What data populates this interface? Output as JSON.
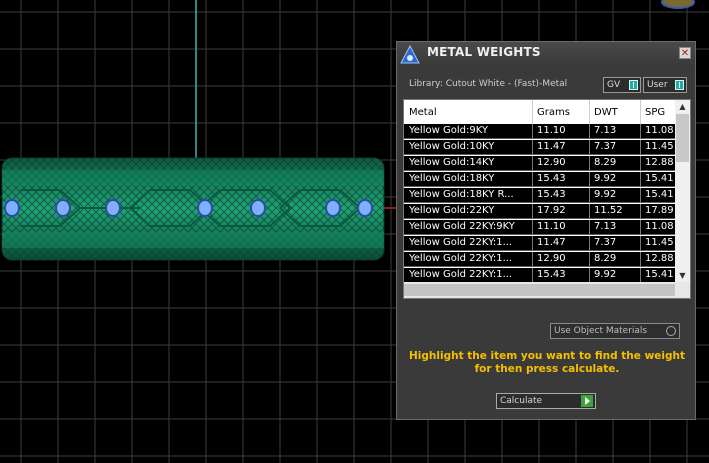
{
  "window": {
    "title": "METAL WEIGHTS",
    "close_label": "✕"
  },
  "library": {
    "label": "Library: Cutout White - (Fast)-Metal",
    "toggles": [
      {
        "label": "GV"
      },
      {
        "label": "User"
      }
    ]
  },
  "table": {
    "columns": [
      "Metal",
      "Grams",
      "DWT",
      "SPG"
    ],
    "rows": [
      {
        "metal": "Yellow Gold:9KY",
        "grams": "11.10",
        "dwt": "7.13",
        "spg": "11.08"
      },
      {
        "metal": "Yellow Gold:10KY",
        "grams": "11.47",
        "dwt": "7.37",
        "spg": "11.45"
      },
      {
        "metal": "Yellow Gold:14KY",
        "grams": "12.90",
        "dwt": "8.29",
        "spg": "12.88"
      },
      {
        "metal": "Yellow Gold:18KY",
        "grams": "15.43",
        "dwt": "9.92",
        "spg": "15.41"
      },
      {
        "metal": "Yellow Gold:18KY R...",
        "grams": "15.43",
        "dwt": "9.92",
        "spg": "15.41"
      },
      {
        "metal": "Yellow Gold:22KY",
        "grams": "17.92",
        "dwt": "11.52",
        "spg": "17.89"
      },
      {
        "metal": "Yellow Gold 22KY:9KY",
        "grams": "11.10",
        "dwt": "7.13",
        "spg": "11.08"
      },
      {
        "metal": "Yellow Gold 22KY:1...",
        "grams": "11.47",
        "dwt": "7.37",
        "spg": "11.45"
      },
      {
        "metal": "Yellow Gold 22KY:1...",
        "grams": "12.90",
        "dwt": "8.29",
        "spg": "12.88"
      },
      {
        "metal": "Yellow Gold 22KY:1...",
        "grams": "15.43",
        "dwt": "9.92",
        "spg": "15.41"
      },
      {
        "metal": "Yellow Gold 22KY:1...",
        "grams": "15.43",
        "dwt": "9.92",
        "spg": "15.41"
      }
    ]
  },
  "object_materials": {
    "label": "Use Object Materials"
  },
  "hint": {
    "line1": "Highlight the item you want to find the weight",
    "line2": "for then press calculate."
  },
  "calculate": {
    "label": "Calculate"
  },
  "colors": {
    "background": "#000000",
    "ring": "#1a9a72",
    "gem": "#7fb0ff",
    "hint": "#f6c000",
    "axis": "#3fb0c0"
  },
  "icons": [
    "logo-icon",
    "close-icon",
    "chevron-up-icon",
    "chevron-down-icon",
    "play-icon",
    "radio-icon",
    "corner-orb-icon"
  ]
}
